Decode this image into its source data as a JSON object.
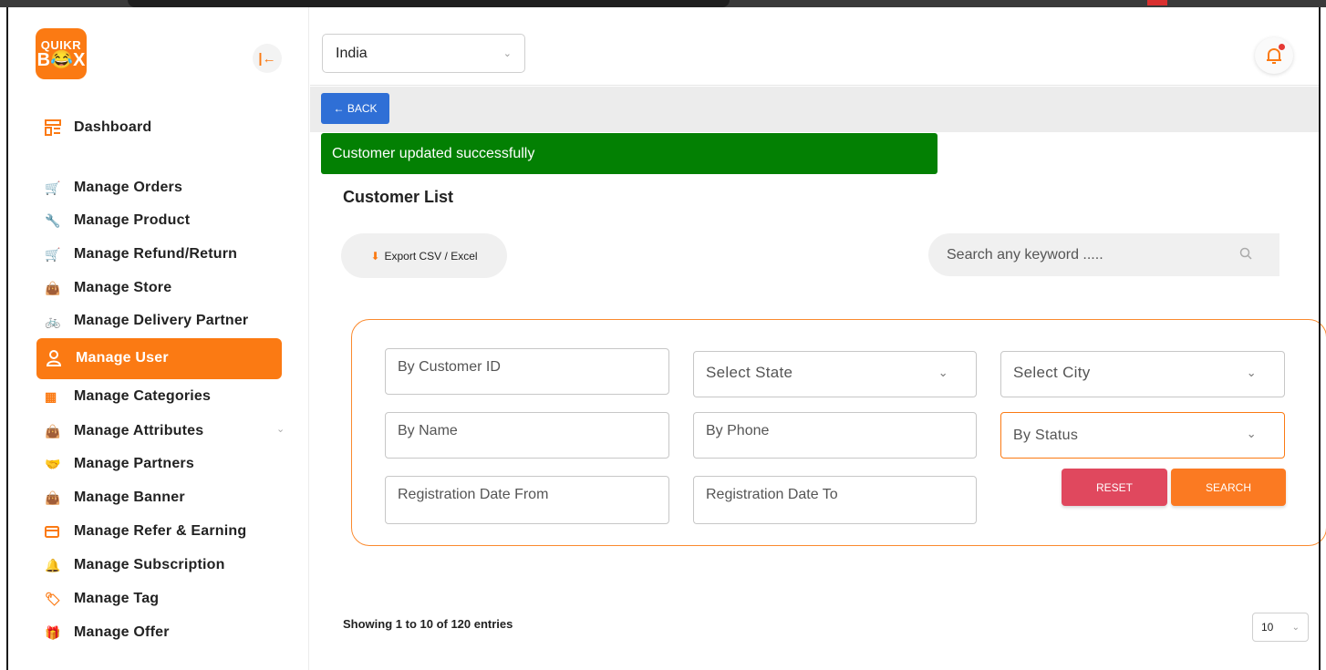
{
  "brand": {
    "logo_line1": "QUIKR",
    "logo_line2": "B😂X",
    "accent": "#fb7a13"
  },
  "sidebar": {
    "collapse_icon": "collapse-left-icon",
    "dashboard": {
      "label": "Dashboard",
      "icon": "dashboard-icon"
    },
    "items": [
      {
        "label": "Manage Orders",
        "icon": "cart-icon"
      },
      {
        "label": "Manage Product",
        "icon": "wrench-icon"
      },
      {
        "label": "Manage Refund/Return",
        "icon": "cart-icon"
      },
      {
        "label": "Manage Store",
        "icon": "bag-icon"
      },
      {
        "label": "Manage Delivery Partner",
        "icon": "bike-icon"
      },
      {
        "label": "Manage User",
        "icon": "user-icon",
        "active": true
      },
      {
        "label": "Manage Categories",
        "icon": "grid-icon"
      },
      {
        "label": "Manage Attributes",
        "icon": "bag-icon"
      },
      {
        "label": "Manage Partners",
        "icon": "handshake-icon"
      },
      {
        "label": "Manage Banner",
        "icon": "bag-icon"
      },
      {
        "label": "Manage Refer & Earning",
        "icon": "card-icon"
      },
      {
        "label": "Manage Subscription",
        "icon": "bell-icon"
      },
      {
        "label": "Manage Tag",
        "icon": "tag-icon"
      },
      {
        "label": "Manage Offer",
        "icon": "gift-icon"
      }
    ]
  },
  "header": {
    "country": "India",
    "notification_icon": "bell-icon"
  },
  "content": {
    "back_label": "← BACK",
    "alert": "Customer updated successfully",
    "title": "Customer List",
    "export_label": "Export CSV / Excel",
    "search_placeholder": "Search any keyword .....",
    "filters": {
      "customer_id": "By Customer ID",
      "state": "Select State",
      "city": "Select City",
      "name": "By Name",
      "phone": "By Phone",
      "status": "By Status",
      "date_from": "Registration Date From",
      "date_to": "Registration Date To"
    },
    "reset_label": "RESET",
    "search_label": "SEARCH",
    "entries_info": "Showing 1 to 10 of 120 entries",
    "page_size": "10"
  }
}
